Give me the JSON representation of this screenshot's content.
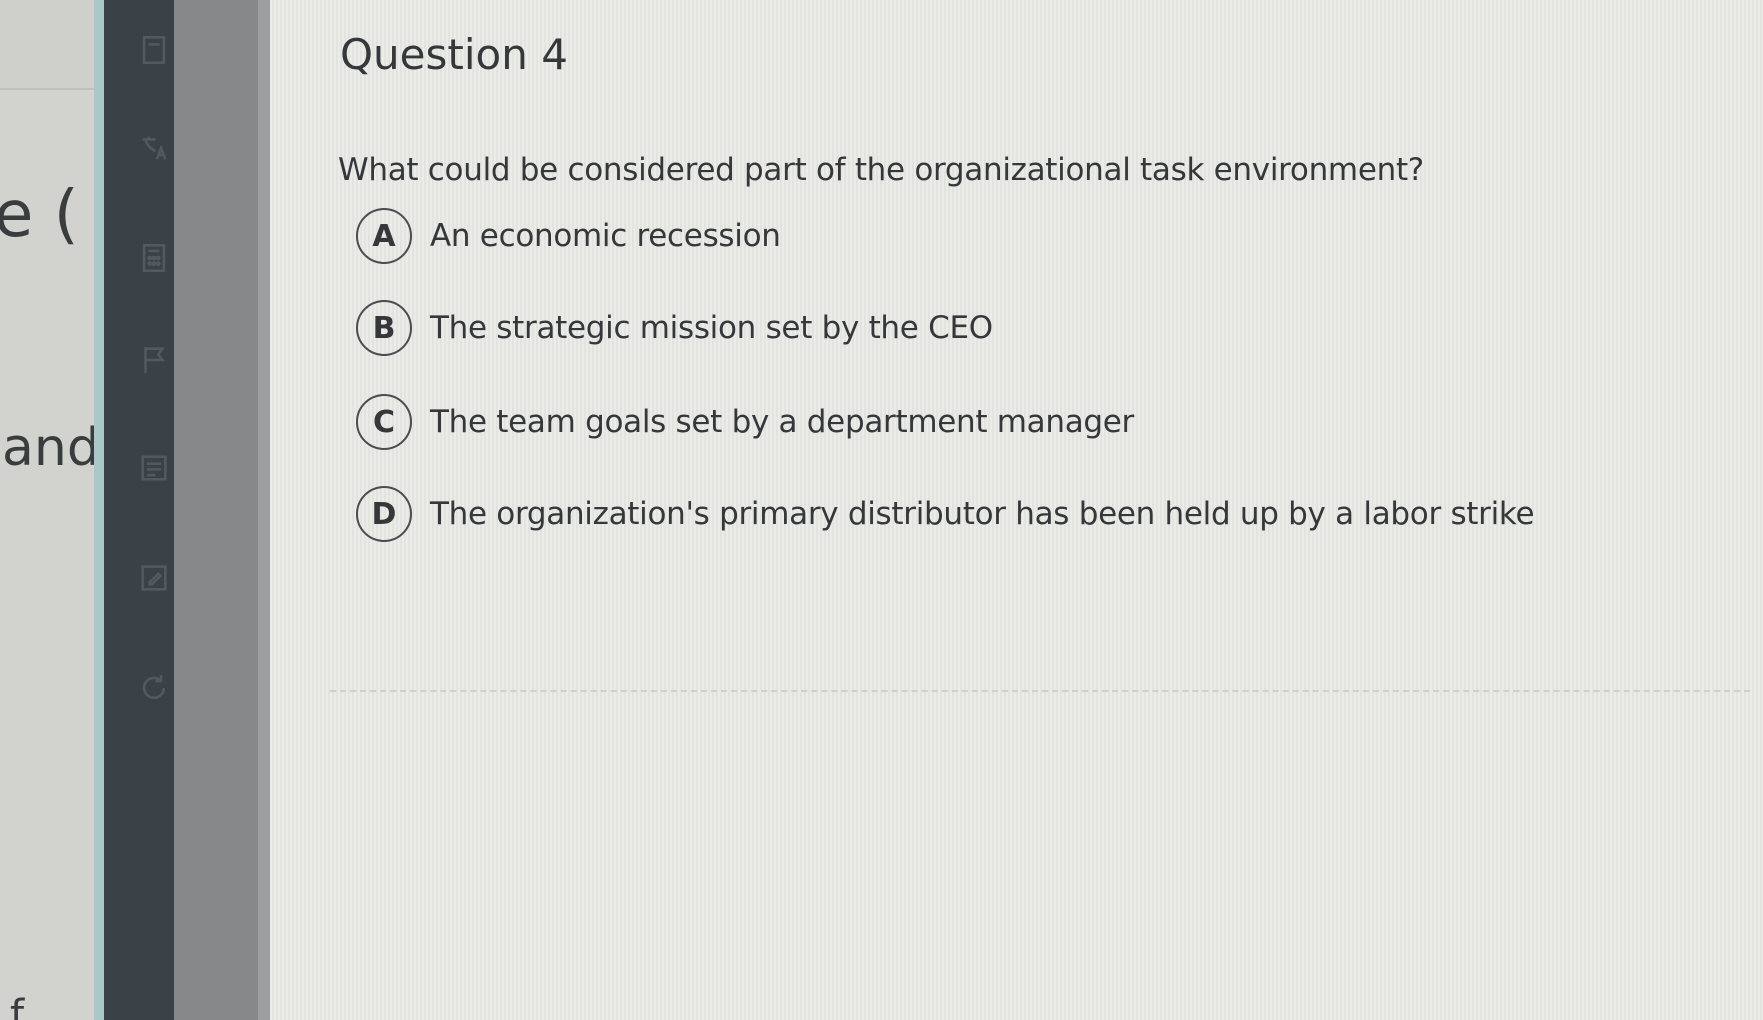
{
  "left_page": {
    "fragment_top": "e (",
    "fragment_middle": "and",
    "fragment_bottom": "f"
  },
  "toolbar": {
    "tools": [
      {
        "icon": "document-icon"
      },
      {
        "icon": "translate-icon"
      },
      {
        "icon": "calculator-icon"
      },
      {
        "icon": "flag-icon"
      },
      {
        "icon": "notes-icon"
      },
      {
        "icon": "pencil-icon"
      },
      {
        "icon": "refresh-icon"
      }
    ]
  },
  "question": {
    "title": "Question 4",
    "text": "What could be considered part of the organizational task environment?",
    "options": [
      {
        "letter": "A",
        "label": "An economic recession"
      },
      {
        "letter": "B",
        "label": "The strategic mission set by the CEO"
      },
      {
        "letter": "C",
        "label": "The team goals set by a department manager"
      },
      {
        "letter": "D",
        "label": "The organization's primary distributor has been held up by a labor strike"
      }
    ]
  }
}
